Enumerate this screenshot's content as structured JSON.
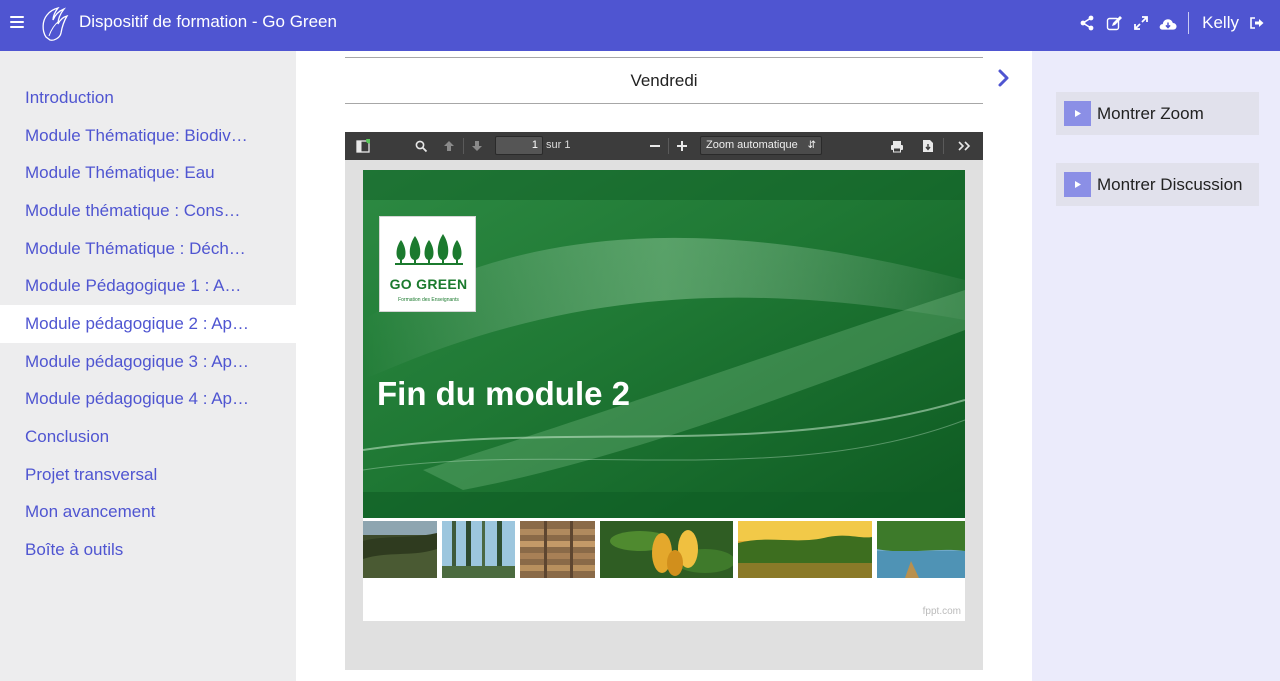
{
  "app": {
    "title": "Dispositif de formation - Go Green",
    "user": "Kelly"
  },
  "toolbar_icons": [
    "share-icon",
    "edit-icon",
    "expand-icon",
    "cloud-download-icon",
    "logout-icon"
  ],
  "sidebar": {
    "items": [
      {
        "label": "Introduction"
      },
      {
        "label": "Module Thématique: Biodiv…"
      },
      {
        "label": "Module Thématique: Eau"
      },
      {
        "label": "Module thématique : Cons…"
      },
      {
        "label": "Module Thématique : Déch…"
      },
      {
        "label": "Module Pédagogique 1 : A…"
      },
      {
        "label": "Module pédagogique 2 : Ap…",
        "active": true
      },
      {
        "label": "Module pédagogique 3 : Ap…"
      },
      {
        "label": "Module pédagogique 4 : Ap…"
      },
      {
        "label": "Conclusion"
      },
      {
        "label": "Projet transversal"
      },
      {
        "label": "Mon avancement"
      },
      {
        "label": "Boîte à outils"
      }
    ]
  },
  "main": {
    "day": "Vendredi",
    "pdf": {
      "page": "1",
      "of": "sur 1",
      "zoom": "Zoom automatique",
      "slide_title": "Fin du module 2",
      "logo_text": "GO GREEN",
      "logo_subtext": "Formation des Enseignants",
      "credit": "fppt.com"
    }
  },
  "right_panel": {
    "zoom_button": "Montrer Zoom",
    "discussion_button": "Montrer Discussion"
  },
  "colors": {
    "accent": "#4f55d1",
    "sidebar_bg": "#ededee",
    "right_panel_bg": "#ebebfb",
    "slide_green": "#1d7a34"
  }
}
